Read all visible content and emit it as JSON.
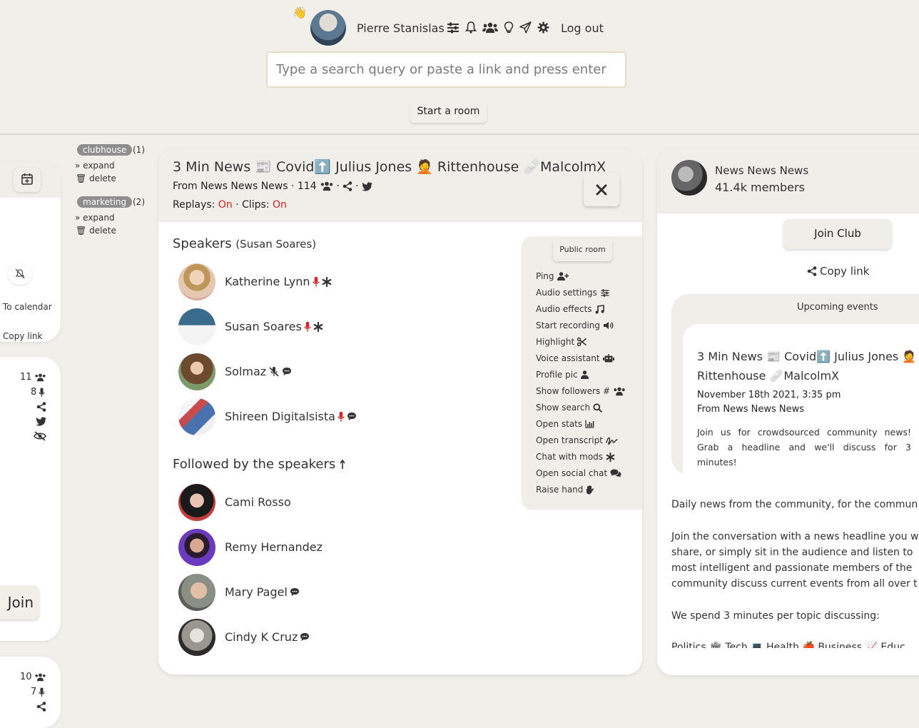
{
  "header": {
    "user_name": "Pierre Stanislas",
    "logout_label": "Log out",
    "search_placeholder": "Type a search query or paste a link and press enter",
    "start_room_label": "Start a room",
    "icons": [
      "wave-icon",
      "sliders-icon",
      "bell-icon",
      "users-icon",
      "lightbulb-icon",
      "send-icon",
      "gear-icon"
    ]
  },
  "left_cards": {
    "card1": {
      "calendar_label": "To calendar",
      "copy_label": "Copy link"
    },
    "card2": {
      "listeners": "11",
      "speakers": "8",
      "join_label": "Join"
    },
    "card3": {
      "listeners": "10",
      "speakers": "7"
    }
  },
  "tags": [
    {
      "name": "clubhouse",
      "count": "(1)",
      "expand": "expand",
      "delete": "delete"
    },
    {
      "name": "marketing",
      "count": "(2)",
      "expand": "expand",
      "delete": "delete"
    }
  ],
  "room": {
    "title": "3 Min News 📰 Covid⬆️ Julius Jones 🤦 Rittenhouse 🩹MalcolmX",
    "from_text": "From News News News · 114",
    "replays_label": "Replays:",
    "replays_value": "On",
    "clips_label": "Clips:",
    "clips_value": "On",
    "speakers_heading": "Speakers",
    "speakers_moderator": "(Susan Soares)",
    "speakers": [
      {
        "name": "Katherine Lynn"
      },
      {
        "name": "Susan Soares"
      },
      {
        "name": "Solmaz"
      },
      {
        "name": "Shireen Digitalsista"
      }
    ],
    "followed_heading": "Followed by the speakers",
    "followed": [
      {
        "name": "Cami Rosso"
      },
      {
        "name": "Remy Hernandez"
      },
      {
        "name": "Mary Pagel"
      },
      {
        "name": "Cindy K Cruz"
      }
    ],
    "menu": {
      "public_room_label": "Public room",
      "items": [
        "Ping",
        "Audio settings",
        "Audio effects",
        "Start recording",
        "Highlight",
        "Voice assistant",
        "Profile pic",
        "Show followers #",
        "Show search",
        "Open stats",
        "Open transcript",
        "Chat with mods",
        "Open social chat",
        "Raise hand"
      ]
    }
  },
  "club": {
    "name": "News News News",
    "members": "41.4k members",
    "join_label": "Join Club",
    "copy_link_label": "Copy link",
    "upcoming_label": "Upcoming events",
    "event": {
      "title": "3 Min News 📰 Covid⬆️ Julius Jones 🤦 Rittenhouse 🩹MalcolmX",
      "date": "November 18th 2021, 3:35 pm",
      "from": "From News News News",
      "description": "Join us for crowdsourced community news! Grab a headline and we'll discuss for 3 minutes!"
    },
    "description_lines": [
      "Daily news from the community, for the commun",
      "",
      "Join the conversation with a news headline you w",
      "share, or simply sit in the audience and listen to",
      "most intelligent and passionate members of the",
      "community discuss current events from all over t",
      "",
      "We spend 3 minutes per topic discussing:",
      "",
      "Politics 🏛 Tech 💻 Health 🍎 Business 📈 Educ"
    ]
  },
  "colors": {
    "accent_red": "#e02020",
    "background": "#f1efe9",
    "panel": "#ffffff"
  }
}
